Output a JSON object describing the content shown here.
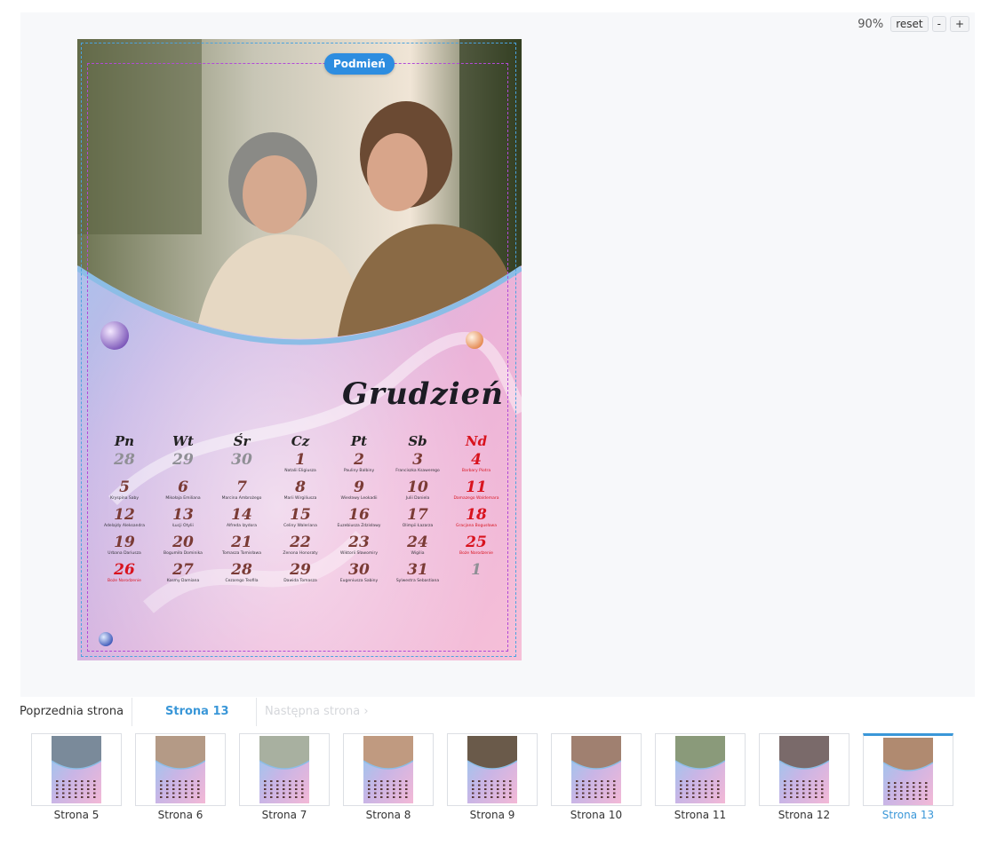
{
  "toolbar": {
    "zoom": "90%",
    "reset_label": "reset",
    "zoom_out_label": "-",
    "zoom_in_label": "+"
  },
  "page": {
    "replace_label": "Podmień",
    "month": "Grudzień"
  },
  "calendar": {
    "weekdays": [
      {
        "label": "Pn",
        "red": false
      },
      {
        "label": "Wt",
        "red": false
      },
      {
        "label": "Śr",
        "red": false
      },
      {
        "label": "Cz",
        "red": false
      },
      {
        "label": "Pt",
        "red": false
      },
      {
        "label": "Sb",
        "red": false
      },
      {
        "label": "Nd",
        "red": true
      }
    ],
    "weeks": [
      [
        {
          "d": "28",
          "n": "",
          "s": "grey"
        },
        {
          "d": "29",
          "n": "",
          "s": "grey"
        },
        {
          "d": "30",
          "n": "",
          "s": "grey"
        },
        {
          "d": "1",
          "n": "Natalii Eligiusza",
          "s": ""
        },
        {
          "d": "2",
          "n": "Pauliny Balbiny",
          "s": ""
        },
        {
          "d": "3",
          "n": "Franciszka Ksawerego",
          "s": ""
        },
        {
          "d": "4",
          "n": "Barbary Piotra",
          "s": "red"
        }
      ],
      [
        {
          "d": "5",
          "n": "Kryspina Saby",
          "s": ""
        },
        {
          "d": "6",
          "n": "Mikołaja Emiliana",
          "s": ""
        },
        {
          "d": "7",
          "n": "Marcina Ambrożego",
          "s": ""
        },
        {
          "d": "8",
          "n": "Marii Wirgiliusza",
          "s": ""
        },
        {
          "d": "9",
          "n": "Wiesławy Leokadii",
          "s": ""
        },
        {
          "d": "10",
          "n": "Julii Daniela",
          "s": ""
        },
        {
          "d": "11",
          "n": "Damazego Waldemara",
          "s": "red"
        }
      ],
      [
        {
          "d": "12",
          "n": "Adelajdy Aleksandra",
          "s": ""
        },
        {
          "d": "13",
          "n": "Łucji Otylii",
          "s": ""
        },
        {
          "d": "14",
          "n": "Alfreda Izydora",
          "s": ""
        },
        {
          "d": "15",
          "n": "Celiny Waleriana",
          "s": ""
        },
        {
          "d": "16",
          "n": "Euzebiusza Zdzisławy",
          "s": ""
        },
        {
          "d": "17",
          "n": "Olimpii Łazarza",
          "s": ""
        },
        {
          "d": "18",
          "n": "Gracjana Bogusława",
          "s": "red"
        }
      ],
      [
        {
          "d": "19",
          "n": "Urbana Dariusza",
          "s": ""
        },
        {
          "d": "20",
          "n": "Bogumiła Dominika",
          "s": ""
        },
        {
          "d": "21",
          "n": "Tomasza Tomisława",
          "s": ""
        },
        {
          "d": "22",
          "n": "Zenona Honoraty",
          "s": ""
        },
        {
          "d": "23",
          "n": "Wiktorii Sławomiry",
          "s": ""
        },
        {
          "d": "24",
          "n": "Wigilia",
          "s": ""
        },
        {
          "d": "25",
          "n": "Boże Narodzenie",
          "s": "red"
        }
      ],
      [
        {
          "d": "26",
          "n": "Boże Narodzenie",
          "s": "red"
        },
        {
          "d": "27",
          "n": "Kosmy Damiana",
          "s": ""
        },
        {
          "d": "28",
          "n": "Cezarego Teofila",
          "s": ""
        },
        {
          "d": "29",
          "n": "Dawida Tomasza",
          "s": ""
        },
        {
          "d": "30",
          "n": "Eugeniusza Sabiny",
          "s": ""
        },
        {
          "d": "31",
          "n": "Sylwestra Sebastiana",
          "s": ""
        },
        {
          "d": "1",
          "n": "",
          "s": "grey"
        }
      ]
    ]
  },
  "pager": {
    "prev_label": "Poprzednia strona",
    "current_label": "Strona 13",
    "next_label": "Następna strona ›"
  },
  "thumbnails": [
    {
      "label": "Strona 5",
      "active": false
    },
    {
      "label": "Strona 6",
      "active": false
    },
    {
      "label": "Strona 7",
      "active": false
    },
    {
      "label": "Strona 8",
      "active": false
    },
    {
      "label": "Strona 9",
      "active": false
    },
    {
      "label": "Strona 10",
      "active": false
    },
    {
      "label": "Strona 11",
      "active": false
    },
    {
      "label": "Strona 12",
      "active": false
    },
    {
      "label": "Strona 13",
      "active": true
    }
  ],
  "colors": {
    "accent": "#3a97d8",
    "holiday": "#d8131e",
    "date": "#7a3b35"
  }
}
